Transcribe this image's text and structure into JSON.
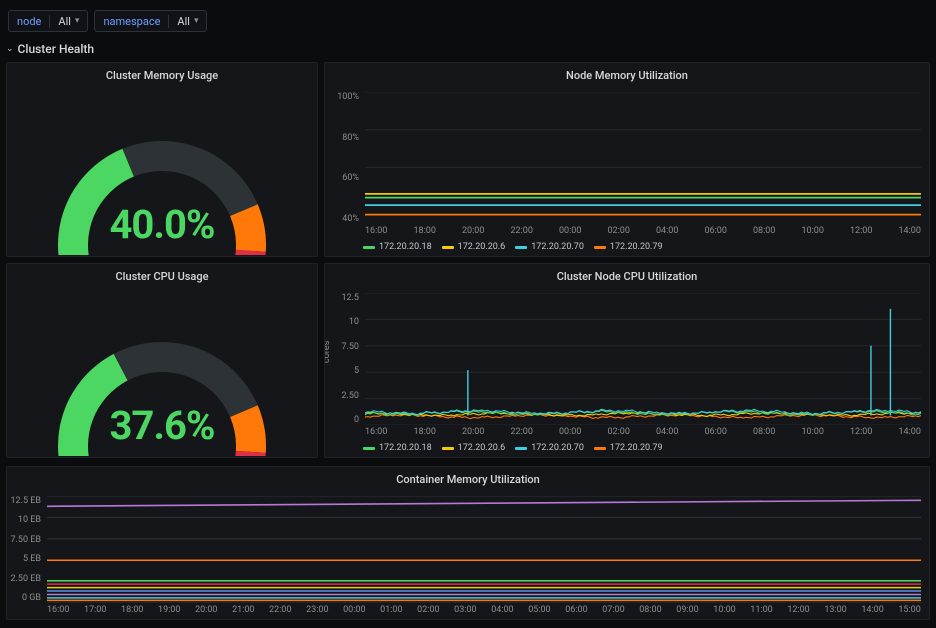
{
  "vars": [
    {
      "label": "node",
      "value": "All"
    },
    {
      "label": "namespace",
      "value": "All"
    }
  ],
  "row_title": "Cluster Health",
  "gauges": {
    "memory": {
      "title": "Cluster Memory Usage",
      "pct": 40.0,
      "display": "40.0%"
    },
    "cpu": {
      "title": "Cluster CPU Usage",
      "pct": 37.6,
      "display": "37.6%"
    }
  },
  "colors": {
    "green": "#4bd762",
    "yellow": "#f2cc0c",
    "cyan": "#3ecfe0",
    "orange": "#ff780a",
    "red": "#e02f44",
    "purple": "#b877d9",
    "blue": "#5794f2"
  },
  "nodes": [
    "172.20.20.18",
    "172.20.20.6",
    "172.20.20.70",
    "172.20.20.79"
  ],
  "x_ticks": [
    "16:00",
    "18:00",
    "20:00",
    "22:00",
    "00:00",
    "02:00",
    "04:00",
    "06:00",
    "08:00",
    "10:00",
    "12:00",
    "14:00"
  ],
  "chart_data": [
    {
      "title": "Node Memory Utilization",
      "type": "line",
      "yticks": [
        "100%",
        "80%",
        "60%",
        "40%"
      ],
      "ylabel": "",
      "ylim": [
        30,
        100
      ],
      "series": [
        {
          "name": "172.20.20.18",
          "color": "#4bd762",
          "value": 44
        },
        {
          "name": "172.20.20.6",
          "color": "#f2cc0c",
          "value": 46
        },
        {
          "name": "172.20.20.70",
          "color": "#3ecfe0",
          "value": 40
        },
        {
          "name": "172.20.20.79",
          "color": "#ff780a",
          "value": 35
        }
      ]
    },
    {
      "title": "Cluster Node CPU Utilization",
      "type": "line",
      "yticks": [
        "12.5",
        "10",
        "7.50",
        "5",
        "2.50",
        "0"
      ],
      "ylabel": "cores",
      "ylim": [
        0,
        12.5
      ],
      "baseline": 0.9,
      "spikes": [
        {
          "x_frac": 0.185,
          "height": 5.2,
          "color": "#3ecfe0"
        },
        {
          "x_frac": 0.91,
          "height": 7.5,
          "color": "#3ecfe0"
        },
        {
          "x_frac": 0.945,
          "height": 11.0,
          "color": "#3ecfe0"
        }
      ],
      "series": [
        {
          "name": "172.20.20.18",
          "color": "#4bd762"
        },
        {
          "name": "172.20.20.6",
          "color": "#f2cc0c"
        },
        {
          "name": "172.20.20.70",
          "color": "#3ecfe0"
        },
        {
          "name": "172.20.20.79",
          "color": "#ff780a"
        }
      ]
    },
    {
      "title": "Container Memory Utilization",
      "type": "line",
      "yticks": [
        "12.5 EB",
        "10 EB",
        "7.50 EB",
        "5 EB",
        "2.50 EB",
        "0 GB"
      ],
      "ylabel": "",
      "ylim": [
        0,
        12.5
      ],
      "x_ticks": [
        "16:00",
        "17:00",
        "18:00",
        "19:00",
        "20:00",
        "21:00",
        "22:00",
        "23:00",
        "00:00",
        "01:00",
        "02:00",
        "03:00",
        "04:00",
        "05:00",
        "06:00",
        "07:00",
        "08:00",
        "09:00",
        "10:00",
        "11:00",
        "12:00",
        "13:00",
        "14:00",
        "15:00"
      ],
      "top_line": {
        "start": 11.3,
        "end": 12.0,
        "color": "#b877d9"
      },
      "bands": [
        {
          "value": 5.0,
          "color": "#ff780a"
        },
        {
          "value": 2.6,
          "color": "#4bd762"
        },
        {
          "value": 2.2,
          "color": "#e02f44"
        },
        {
          "value": 1.8,
          "color": "#f2cc0c"
        },
        {
          "value": 1.4,
          "color": "#5794f2"
        },
        {
          "value": 1.0,
          "color": "#b877d9"
        },
        {
          "value": 0.6,
          "color": "#3ecfe0"
        },
        {
          "value": 0.3,
          "color": "#ff780a"
        }
      ]
    }
  ]
}
